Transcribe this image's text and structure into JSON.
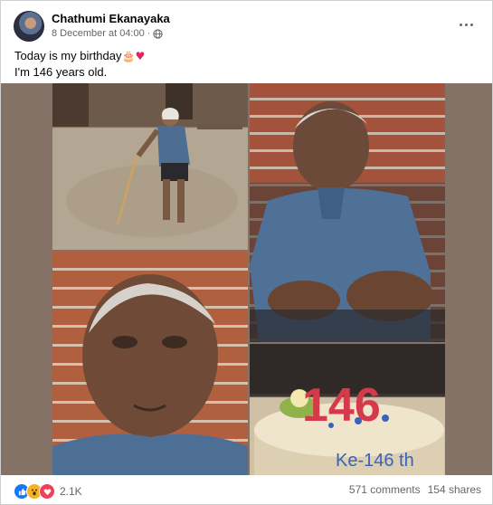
{
  "post": {
    "author": "Chathumi Ekanayaka",
    "timestamp": "8 December at 04:00",
    "dot": "·",
    "text_line1": "Today is my birthday",
    "text_line1_emoji": "🎂",
    "text_line1_heart": "♥",
    "text_line2": "I'm 146 years old.",
    "more_icon": "more-horizontal-icon"
  },
  "photo": {
    "background": "#857266",
    "cake_label": "146",
    "cake_writing": "Ke-146 th"
  },
  "footer": {
    "reaction_count": "2.1K",
    "comments": "571 comments",
    "shares": "154 shares",
    "reaction_icons": [
      "like-icon",
      "wow-icon",
      "love-icon"
    ]
  },
  "colors": {
    "like": "#1877f2",
    "wow": "#f7b125",
    "love": "#f33e58",
    "meta_text": "#65676b"
  }
}
